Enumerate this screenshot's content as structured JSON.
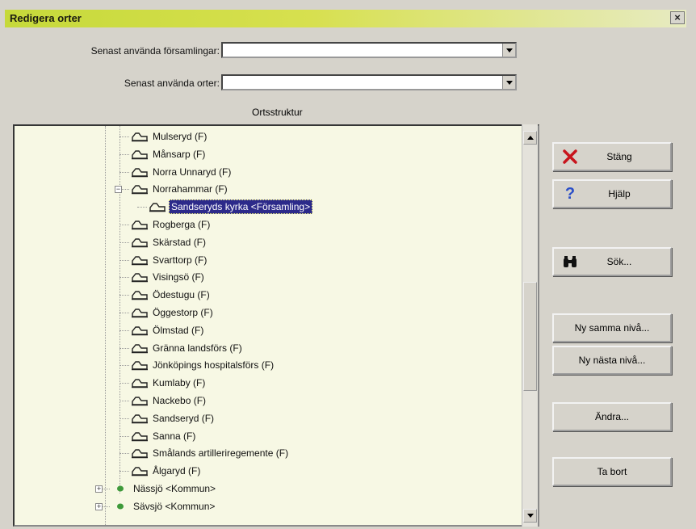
{
  "window": {
    "title": "Redigera orter",
    "close_label": "×"
  },
  "form": {
    "recent_parishes_label": "Senast använda församlingar:",
    "recent_parishes_value": "",
    "recent_places_label": "Senast använda orter:",
    "recent_places_value": ""
  },
  "tree": {
    "group_label": "Ortsstruktur",
    "items": [
      {
        "label": "Mulseryd (F)",
        "level": 2
      },
      {
        "label": "Månsarp (F)",
        "level": 2
      },
      {
        "label": "Norra Unnaryd (F)",
        "level": 2
      },
      {
        "label": "Norrahammar (F)",
        "level": 2,
        "expander": "minus"
      },
      {
        "label": "Sandseryds kyrka <Församling>",
        "level": 3,
        "selected": true
      },
      {
        "label": "Rogberga (F)",
        "level": 2
      },
      {
        "label": "Skärstad (F)",
        "level": 2
      },
      {
        "label": "Svarttorp (F)",
        "level": 2
      },
      {
        "label": "Visingsö (F)",
        "level": 2
      },
      {
        "label": "Ödestugu (F)",
        "level": 2
      },
      {
        "label": "Öggestorp (F)",
        "level": 2
      },
      {
        "label": "Ölmstad (F)",
        "level": 2
      },
      {
        "label": "Gränna landsförs (F)",
        "level": 2
      },
      {
        "label": "Jönköpings hospitalsförs (F)",
        "level": 2
      },
      {
        "label": "Kumlaby (F)",
        "level": 2
      },
      {
        "label": "Nackebo (F)",
        "level": 2
      },
      {
        "label": "Sandseryd (F)",
        "level": 2
      },
      {
        "label": "Sanna (F)",
        "level": 2
      },
      {
        "label": "Smålands artilleriregemente (F)",
        "level": 2
      },
      {
        "label": "Ålgaryd (F)",
        "level": 2
      },
      {
        "label": "Nässjö <Kommun>",
        "level": 1,
        "expander": "plus",
        "icon": "green-dot"
      },
      {
        "label": "Sävsjö <Kommun>",
        "level": 1,
        "expander": "plus",
        "icon": "green-dot"
      }
    ]
  },
  "buttons": {
    "close": "Stäng",
    "help": "Hjälp",
    "search": "Sök...",
    "new_same_level": "Ny samma nivå...",
    "new_next_level": "Ny nästa nivå...",
    "change": "Ändra...",
    "delete": "Ta bort"
  },
  "icons": {
    "place": "house-icon",
    "municipality": "green-dot-icon",
    "close": "red-x-icon",
    "help": "question-mark-icon",
    "search": "binoculars-icon"
  },
  "colors": {
    "title_gradient_start": "#c6d93a",
    "tree_background": "#f7f8e4",
    "selection": "#2c2a8a",
    "help_icon": "#2a4ec8",
    "close_icon": "#c8141c"
  }
}
